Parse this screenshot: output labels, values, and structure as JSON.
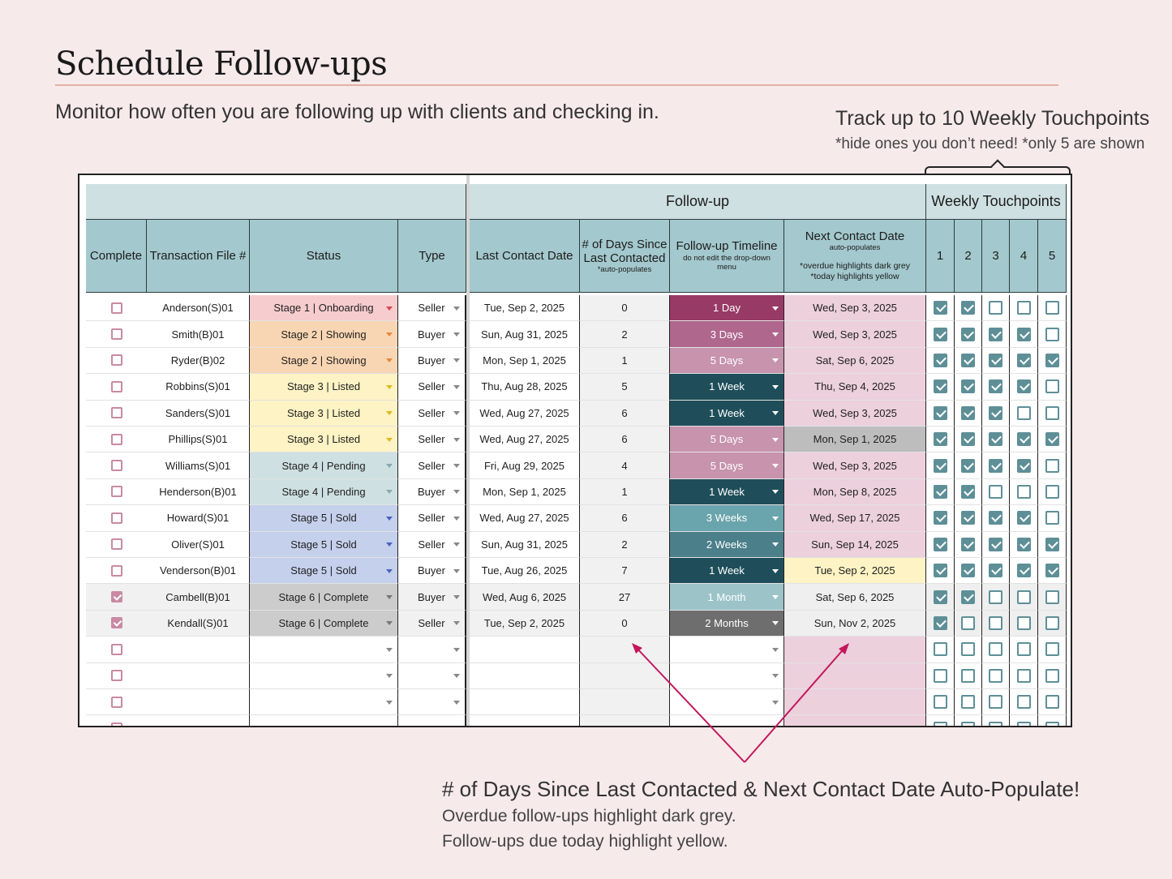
{
  "page": {
    "title": "Schedule Follow-ups",
    "subtitle": "Monitor how often you are following up with clients and checking in.",
    "touchpoints_title": "Track up to 10 Weekly Touchpoints",
    "touchpoints_note": "*hide ones you don’t need! *only 5 are shown",
    "callout_title": "# of Days Since Last Contacted & Next Contact Date Auto-Populate!",
    "callout_line1": "Overdue follow-ups highlight dark grey.",
    "callout_line2": "Follow-ups due today highlight yellow."
  },
  "table": {
    "group_followup": "Follow-up",
    "group_touchpoints": "Weekly Touchpoints",
    "headers": {
      "complete": "Complete",
      "transaction": "Transaction File #",
      "status": "Status",
      "type": "Type",
      "last_contact": "Last Contact Date",
      "days_since_1": "# of Days Since",
      "days_since_2": "Last Contacted",
      "days_since_note": "*auto-populates",
      "timeline": "Follow-up Timeline",
      "timeline_note_1": "do not edit the drop-down",
      "timeline_note_2": "menu",
      "next_contact": "Next Contact Date",
      "next_contact_note": "auto-populates",
      "next_contact_note_2": "*overdue highlights dark grey",
      "next_contact_note_3": "*today highlights yellow",
      "tp": [
        "1",
        "2",
        "3",
        "4",
        "5"
      ]
    },
    "rows": [
      {
        "complete": false,
        "file": "Anderson(S)01",
        "status": "Stage 1 | Onboarding",
        "status_color": "#f6ccce",
        "status_arrow": "#d9464f",
        "type": "Seller",
        "last": "Tue, Sep 2, 2025",
        "days": "0",
        "timeline": "1 Day",
        "tl_color": "#973a66",
        "next": "Wed, Sep 3, 2025",
        "next_color": "#ecd0dc",
        "tp": [
          true,
          true,
          false,
          false,
          false
        ]
      },
      {
        "complete": false,
        "file": "Smith(B)01",
        "status": "Stage 2 | Showing",
        "status_color": "#f9d6b3",
        "status_arrow": "#e8883c",
        "type": "Buyer",
        "last": "Sun, Aug 31, 2025",
        "days": "2",
        "timeline": "3 Days",
        "tl_color": "#b0678d",
        "next": "Wed, Sep 3, 2025",
        "next_color": "#ecd0dc",
        "tp": [
          true,
          true,
          true,
          true,
          false
        ]
      },
      {
        "complete": false,
        "file": "Ryder(B)02",
        "status": "Stage 2 | Showing",
        "status_color": "#f9d6b3",
        "status_arrow": "#e8883c",
        "type": "Buyer",
        "last": "Mon, Sep 1, 2025",
        "days": "1",
        "timeline": "5 Days",
        "tl_color": "#c793ad",
        "next": "Sat, Sep 6, 2025",
        "next_color": "#ecd0dc",
        "tp": [
          true,
          true,
          true,
          true,
          true
        ]
      },
      {
        "complete": false,
        "file": "Robbins(S)01",
        "status": "Stage 3 | Listed",
        "status_color": "#fdf3c4",
        "status_arrow": "#e0b820",
        "type": "Seller",
        "last": "Thu, Aug 28, 2025",
        "days": "5",
        "timeline": "1 Week",
        "tl_color": "#1f4e5a",
        "next": "Thu, Sep 4, 2025",
        "next_color": "#ecd0dc",
        "tp": [
          true,
          true,
          true,
          true,
          false
        ]
      },
      {
        "complete": false,
        "file": "Sanders(S)01",
        "status": "Stage 3 | Listed",
        "status_color": "#fdf3c4",
        "status_arrow": "#e0b820",
        "type": "Seller",
        "last": "Wed, Aug 27, 2025",
        "days": "6",
        "timeline": "1 Week",
        "tl_color": "#1f4e5a",
        "next": "Wed, Sep 3, 2025",
        "next_color": "#ecd0dc",
        "tp": [
          true,
          true,
          true,
          false,
          false
        ]
      },
      {
        "complete": false,
        "file": "Phillips(S)01",
        "status": "Stage 3 | Listed",
        "status_color": "#fdf3c4",
        "status_arrow": "#e0b820",
        "type": "Seller",
        "last": "Wed, Aug 27, 2025",
        "days": "6",
        "timeline": "5 Days",
        "tl_color": "#c793ad",
        "next": "Mon, Sep 1, 2025",
        "next_color": "#bdbdbd",
        "tp": [
          true,
          true,
          true,
          true,
          true
        ]
      },
      {
        "complete": false,
        "file": "Williams(S)01",
        "status": "Stage 4 | Pending",
        "status_color": "#cfe0e2",
        "status_arrow": "#8aa9ad",
        "type": "Seller",
        "last": "Fri, Aug 29, 2025",
        "days": "4",
        "timeline": "5 Days",
        "tl_color": "#c793ad",
        "next": "Wed, Sep 3, 2025",
        "next_color": "#ecd0dc",
        "tp": [
          true,
          true,
          true,
          true,
          false
        ]
      },
      {
        "complete": false,
        "file": "Henderson(B)01",
        "status": "Stage 4 | Pending",
        "status_color": "#cfe0e2",
        "status_arrow": "#8aa9ad",
        "type": "Buyer",
        "last": "Mon, Sep 1, 2025",
        "days": "1",
        "timeline": "1 Week",
        "tl_color": "#1f4e5a",
        "next": "Mon, Sep 8, 2025",
        "next_color": "#ecd0dc",
        "tp": [
          true,
          true,
          false,
          false,
          false
        ]
      },
      {
        "complete": false,
        "file": "Howard(S)01",
        "status": "Stage 5 | Sold",
        "status_color": "#c5d0ec",
        "status_arrow": "#4a62c0",
        "type": "Seller",
        "last": "Wed, Aug 27, 2025",
        "days": "6",
        "timeline": "3 Weeks",
        "tl_color": "#6aa4ac",
        "next": "Wed, Sep 17, 2025",
        "next_color": "#ecd0dc",
        "tp": [
          true,
          true,
          true,
          true,
          false
        ]
      },
      {
        "complete": false,
        "file": "Oliver(S)01",
        "status": "Stage 5 | Sold",
        "status_color": "#c5d0ec",
        "status_arrow": "#4a62c0",
        "type": "Seller",
        "last": "Sun, Aug 31, 2025",
        "days": "2",
        "timeline": "2 Weeks",
        "tl_color": "#4b7f8a",
        "next": "Sun, Sep 14, 2025",
        "next_color": "#ecd0dc",
        "tp": [
          true,
          true,
          true,
          true,
          true
        ]
      },
      {
        "complete": false,
        "file": "Venderson(B)01",
        "status": "Stage 5 | Sold",
        "status_color": "#c5d0ec",
        "status_arrow": "#4a62c0",
        "type": "Buyer",
        "last": "Tue, Aug 26, 2025",
        "days": "7",
        "timeline": "1 Week",
        "tl_color": "#1f4e5a",
        "next": "Tue, Sep 2, 2025",
        "next_color": "#fdf3c4",
        "tp": [
          true,
          true,
          true,
          true,
          true
        ]
      },
      {
        "complete": true,
        "file": "Cambell(B)01",
        "status": "Stage 6 | Complete",
        "status_color": "#cccccc",
        "status_arrow": "#777777",
        "type": "Buyer",
        "last": "Wed, Aug 6, 2025",
        "days": "27",
        "timeline": "1 Month",
        "tl_color": "#9cc3c8",
        "next": "Sat, Sep 6, 2025",
        "next_color": "#efefef",
        "tp": [
          true,
          true,
          false,
          false,
          false
        ]
      },
      {
        "complete": true,
        "file": "Kendall(S)01",
        "status": "Stage 6 | Complete",
        "status_color": "#cccccc",
        "status_arrow": "#777777",
        "type": "Seller",
        "last": "Tue, Sep 2, 2025",
        "days": "0",
        "timeline": "2 Months",
        "tl_color": "#6e6e6e",
        "next": "Sun, Nov 2, 2025",
        "next_color": "#efefef",
        "tp": [
          true,
          false,
          false,
          false,
          false
        ]
      },
      {
        "complete": false,
        "file": "",
        "status": "",
        "status_color": "#ffffff",
        "status_arrow": "#888888",
        "type": "",
        "last": "",
        "days": "",
        "timeline": "",
        "tl_color": "#ffffff",
        "next": "",
        "next_color": "#ecd0dc",
        "tp": [
          false,
          false,
          false,
          false,
          false
        ]
      },
      {
        "complete": false,
        "file": "",
        "status": "",
        "status_color": "#ffffff",
        "status_arrow": "#888888",
        "type": "",
        "last": "",
        "days": "",
        "timeline": "",
        "tl_color": "#ffffff",
        "next": "",
        "next_color": "#ecd0dc",
        "tp": [
          false,
          false,
          false,
          false,
          false
        ]
      },
      {
        "complete": false,
        "file": "",
        "status": "",
        "status_color": "#ffffff",
        "status_arrow": "#888888",
        "type": "",
        "last": "",
        "days": "",
        "timeline": "",
        "tl_color": "#ffffff",
        "next": "",
        "next_color": "#ecd0dc",
        "tp": [
          false,
          false,
          false,
          false,
          false
        ]
      },
      {
        "complete": false,
        "file": "",
        "status": "",
        "status_color": "#ffffff",
        "status_arrow": "#888888",
        "type": "",
        "last": "",
        "days": "",
        "timeline": "",
        "tl_color": "#ffffff",
        "next": "",
        "next_color": "#ecd0dc",
        "tp": [
          false,
          false,
          false,
          false,
          false
        ]
      }
    ]
  },
  "colors": {
    "accent_arrow": "#c2185b",
    "header_fill": "#a3c8cd",
    "touchpoint_check": "#5e8f97",
    "complete_check": "#c98aa2"
  }
}
